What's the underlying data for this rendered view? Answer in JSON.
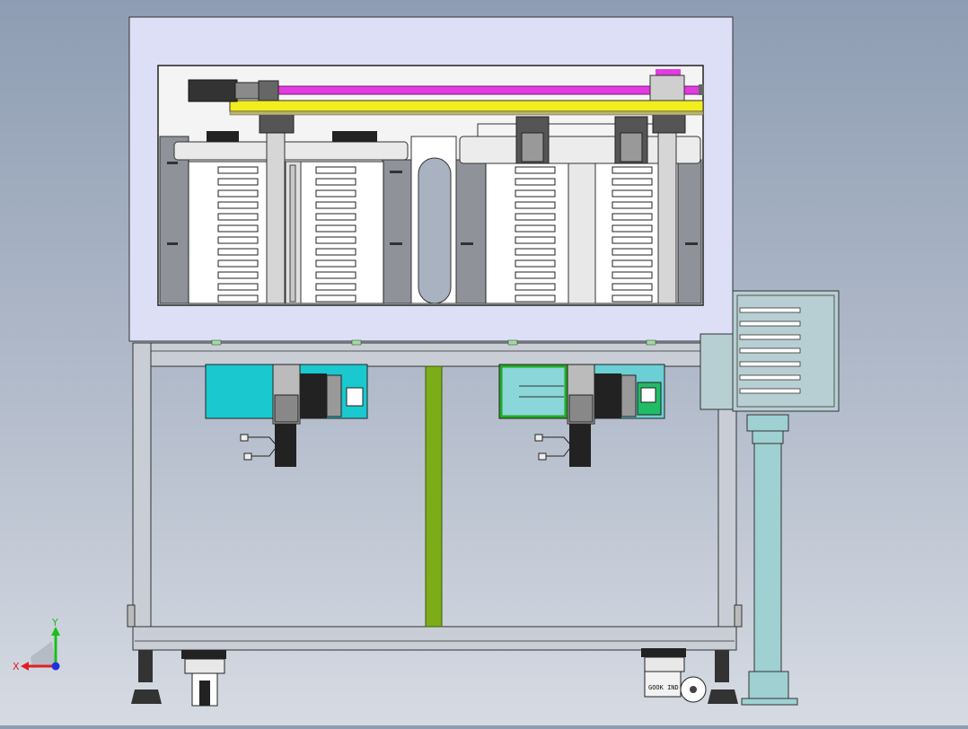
{
  "viewport": {
    "background_top": "#8e9db3",
    "background_bottom": "#d6dbe3"
  },
  "model": {
    "caster_brand_text": "GOOK IND",
    "colors": {
      "frame": "#c9ced6",
      "window_panel": "#dcdff5",
      "yellow_rail": "#f2ee1e",
      "magenta_screw": "#e23be0",
      "motor_housing": "#19c9cf",
      "green_post": "#7cad18",
      "column": "#9fd0d2",
      "control_box": "#b7cfd3"
    }
  },
  "triad": {
    "x_label": "X",
    "y_label": "Y",
    "x_color": "#e02020",
    "y_color": "#18c018",
    "z_color": "#2030e0"
  }
}
